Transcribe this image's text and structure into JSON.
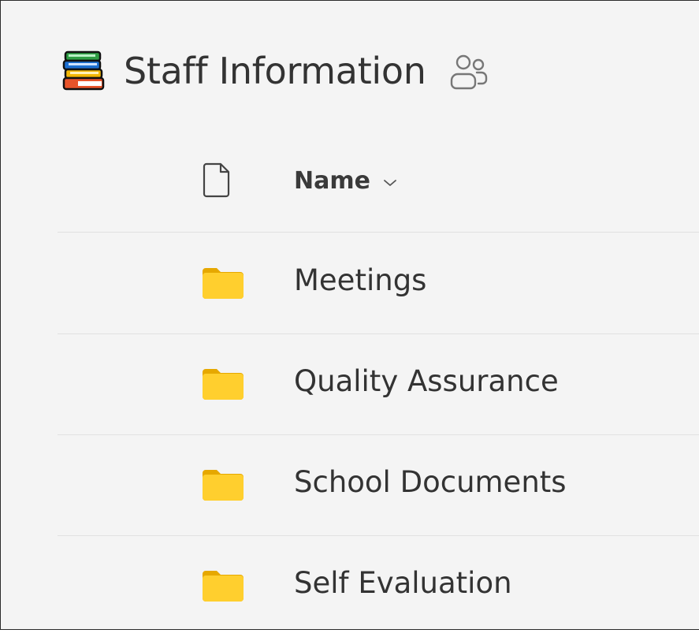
{
  "library": {
    "title": "Staff Information",
    "icon": "books-icon",
    "members_icon": "people-icon"
  },
  "columns": {
    "filetype_icon": "file-icon",
    "name_label": "Name",
    "sort_icon": "chevron-down-icon"
  },
  "items": [
    {
      "name": "Meetings",
      "icon": "folder-icon"
    },
    {
      "name": "Quality Assurance",
      "icon": "folder-icon"
    },
    {
      "name": "School Documents",
      "icon": "folder-icon"
    },
    {
      "name": "Self Evaluation",
      "icon": "folder-icon"
    }
  ],
  "colors": {
    "folder": "#f5c518",
    "background": "#f4f4f4",
    "divider": "#e1e1e1"
  }
}
